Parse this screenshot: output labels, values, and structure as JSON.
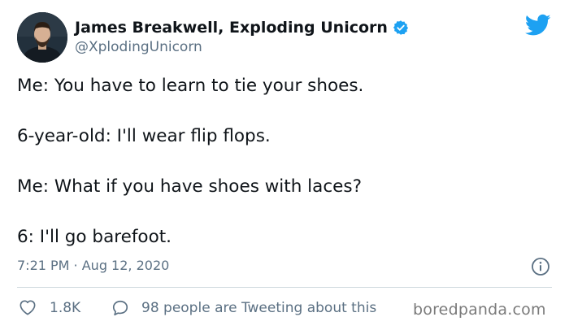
{
  "author": {
    "display_name": "James Breakwell, Exploding Unicorn",
    "handle": "@XplodingUnicorn",
    "verified": true
  },
  "tweet": {
    "lines": [
      "Me: You have to learn to tie your shoes.",
      "6-year-old: I'll wear flip flops.",
      "Me: What if you have shoes with laces?",
      "6: I'll go barefoot."
    ],
    "timestamp": "7:21 PM · Aug 12, 2020"
  },
  "actions": {
    "like_count": "1.8K",
    "reply_text": "98 people are Tweeting about this"
  },
  "watermark": "boredpanda.com",
  "colors": {
    "brand_blue": "#1da1f2",
    "text_primary": "#0f1419",
    "text_secondary": "#5b7083",
    "divider": "#cfd9de"
  },
  "icons": {
    "verified": "verified-badge-icon",
    "platform": "twitter-bird-icon",
    "info": "info-icon",
    "like": "heart-icon",
    "reply": "speech-bubble-icon"
  }
}
